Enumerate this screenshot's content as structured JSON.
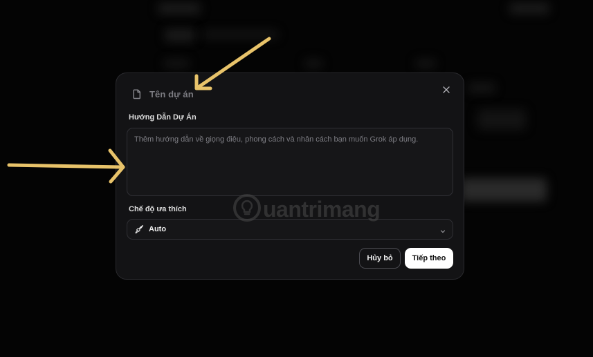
{
  "modal": {
    "project_name": "Tên dự án",
    "instructions_label": "Hướng Dẫn Dự Án",
    "instructions_placeholder": "Thêm hướng dẫn về giọng điệu, phong cách và nhân cách bạn muốn Grok áp dụng.",
    "instructions_value": "",
    "mode_label": "Chế độ ưa thích",
    "mode_value": "Auto",
    "cancel_label": "Hủy bỏ",
    "next_label": "Tiếp theo"
  },
  "watermark": {
    "text": "uantrimang"
  },
  "icons": {
    "header": "file-icon",
    "close": "close-icon",
    "mode": "rocket-icon",
    "dropdown": "chevron-down-icon",
    "watermark": "lightbulb-icon"
  },
  "colors": {
    "background": "#040404",
    "modal_bg": "#131315",
    "border": "#303035",
    "primary_button": "#ffffff",
    "arrow": "#e8c36a"
  }
}
